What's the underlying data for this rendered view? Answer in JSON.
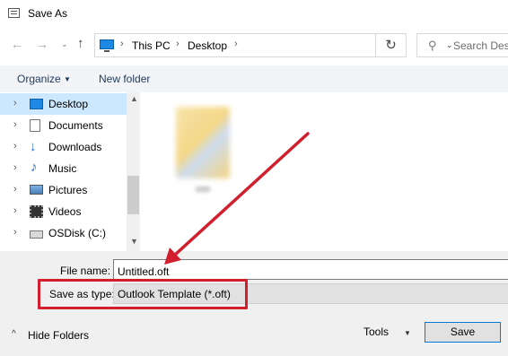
{
  "window": {
    "title": "Save As"
  },
  "nav": {
    "back_icon": "back-arrow-icon",
    "forward_icon": "forward-arrow-icon",
    "up_icon": "up-arrow-icon"
  },
  "address": {
    "crumbs": [
      "This PC",
      "Desktop"
    ],
    "separator": "›"
  },
  "search": {
    "placeholder": "Search Desk"
  },
  "toolbar": {
    "organize_label": "Organize",
    "new_folder_label": "New folder"
  },
  "sidebar": {
    "items": [
      {
        "label": "Desktop",
        "icon": "desktop-icon",
        "selected": true
      },
      {
        "label": "Documents",
        "icon": "documents-icon"
      },
      {
        "label": "Downloads",
        "icon": "downloads-icon"
      },
      {
        "label": "Music",
        "icon": "music-icon"
      },
      {
        "label": "Pictures",
        "icon": "pictures-icon"
      },
      {
        "label": "Videos",
        "icon": "videos-icon"
      },
      {
        "label": "OSDisk (C:)",
        "icon": "drive-icon"
      }
    ]
  },
  "form": {
    "file_name_label": "File name:",
    "file_name_value": "Untitled.oft",
    "save_type_label": "Save as type:",
    "save_type_value": "Outlook Template (*.oft)"
  },
  "footer": {
    "hide_folders_label": "Hide Folders",
    "tools_label": "Tools",
    "save_label": "Save"
  },
  "colors": {
    "accent": "#0078d7",
    "selection": "#cce8ff",
    "annotation_red": "#d11f2d"
  }
}
